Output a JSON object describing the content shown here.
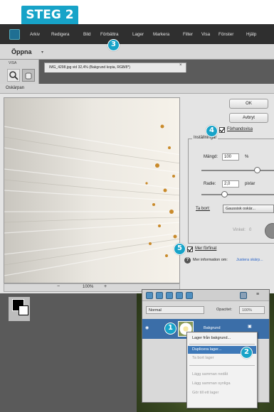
{
  "step_header": "STEG 2",
  "menu": [
    "Arkiv",
    "Redigera",
    "Bild",
    "Förbättra",
    "Lager",
    "Markera",
    "Filter",
    "Visa",
    "Fönster",
    "Hjälp"
  ],
  "open_button": "Öppna",
  "tools_label": "VISA",
  "document_tab": "IMG_4298.jpg vid 32,4% (Bakgrund kopia, RGB/8*)",
  "dialog": {
    "title": "Oskärpan",
    "ok": "OK",
    "cancel": "Avbryt",
    "preview": "Förhandsvisa",
    "settings_legend": "Inställningar",
    "amount_label": "Mängd:",
    "amount_value": "100",
    "amount_unit": "%",
    "radius_label": "Radie:",
    "radius_value": "2,0",
    "radius_unit": "pixlar",
    "remove_label": "Ta bort:",
    "remove_value": "Gaussisk oskär...",
    "angle_label": "Vinkel:",
    "angle_value": "0",
    "more_precise": "Mer förfinat",
    "info_text": "Mer information om:",
    "info_link": "Justera skärp...",
    "zoom_value": "100%",
    "amount_fraction": 0.8,
    "radius_fraction": 0.3
  },
  "layers": {
    "blend_mode": "Normal",
    "opacity_label": "Opacitet:",
    "opacity_value": "100%",
    "layer_name": "Bakgrund"
  },
  "context_menu": [
    "Lager från bakgrund...",
    "Duplicera lager...",
    "Ta bort lager",
    "Lägg samman nedåt",
    "Lägg samman synliga",
    "Gör till ett lager"
  ],
  "badges": [
    "1",
    "2",
    "3",
    "4",
    "5"
  ],
  "colors": {
    "accent": "#17a3c8",
    "highlight": "#3d78b8"
  }
}
